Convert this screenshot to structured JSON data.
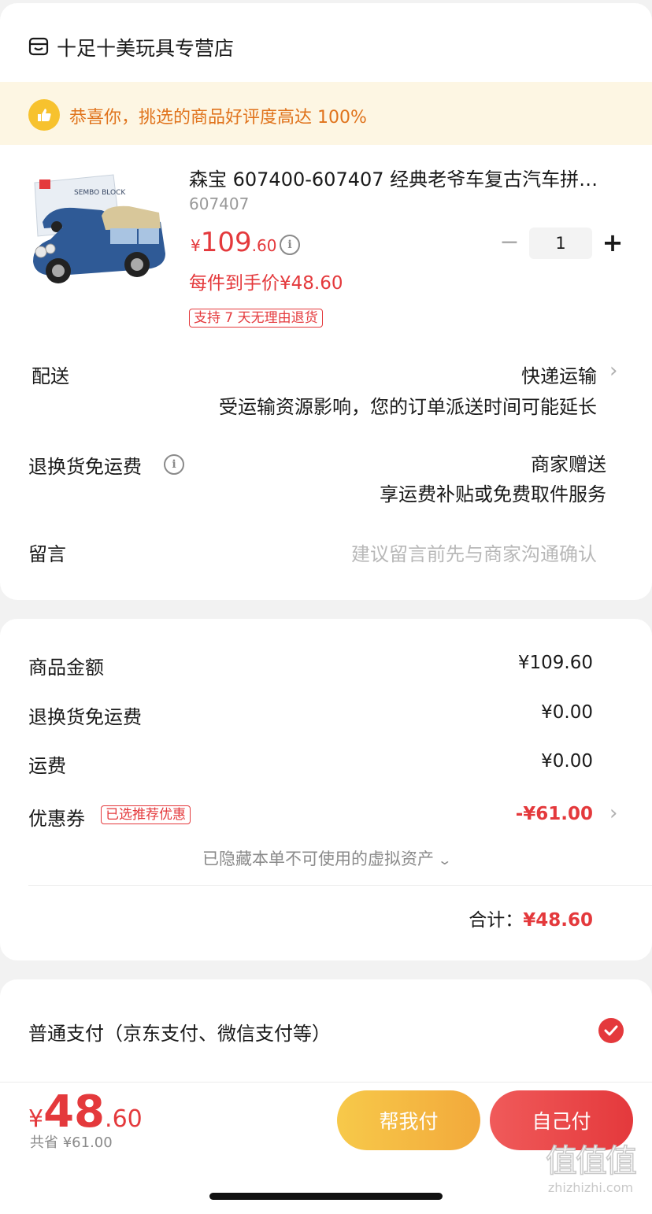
{
  "store": {
    "name": "十足十美玩具专营店",
    "icon": "store-icon"
  },
  "banner": {
    "text": "恭喜你，挑选的商品好评度高达 100%",
    "icon": "thumbs-up-icon"
  },
  "product": {
    "title": "森宝 607400-607407 经典老爷车复古汽车拼…",
    "sku": "607407",
    "price_currency": "¥",
    "price_int": "109",
    "price_dec": ".60",
    "unit_price": "每件到手价¥48.60",
    "return_badge": "支持 7 天无理由退货",
    "quantity": "1",
    "minus_label": "−",
    "plus_label": "+",
    "thumbnail_brand": "SEMBO BLOCK"
  },
  "delivery": {
    "label": "配送",
    "method": "快递运输",
    "note": "受运输资源影响，您的订单派送时间可能延长"
  },
  "return_shipping": {
    "label": "退换货免运费",
    "value": "商家赠送",
    "note": "享运费补贴或免费取件服务"
  },
  "message": {
    "label": "留言",
    "placeholder": "建议留言前先与商家沟通确认"
  },
  "summary": {
    "goods_label": "商品金额",
    "goods_value": "¥109.60",
    "return_label": "退换货免运费",
    "return_value": "¥0.00",
    "shipping_label": "运费",
    "shipping_value": "¥0.00",
    "coupon_label": "优惠券",
    "coupon_badge": "已选推荐优惠",
    "coupon_value": "-¥61.00",
    "hidden_assets": "已隐藏本单不可使用的虚拟资产",
    "total_label": "合计：",
    "total_value": "¥48.60"
  },
  "payment": {
    "option_label": "普通支付（京东支付、微信支付等）",
    "selected": true
  },
  "bottom": {
    "total_currency": "¥",
    "total_int": "48",
    "total_dec": ".60",
    "saved": "共省 ¥61.00",
    "help_pay_label": "帮我付",
    "self_pay_label": "自己付"
  },
  "watermark": {
    "glyphs": "值值值",
    "url": "zhizhizhi.com"
  },
  "colors": {
    "accent_red": "#e4393c",
    "accent_orange": "#e0731c",
    "banner_bg": "#fdf6e3",
    "thumb_yellow": "#f7c22e"
  }
}
